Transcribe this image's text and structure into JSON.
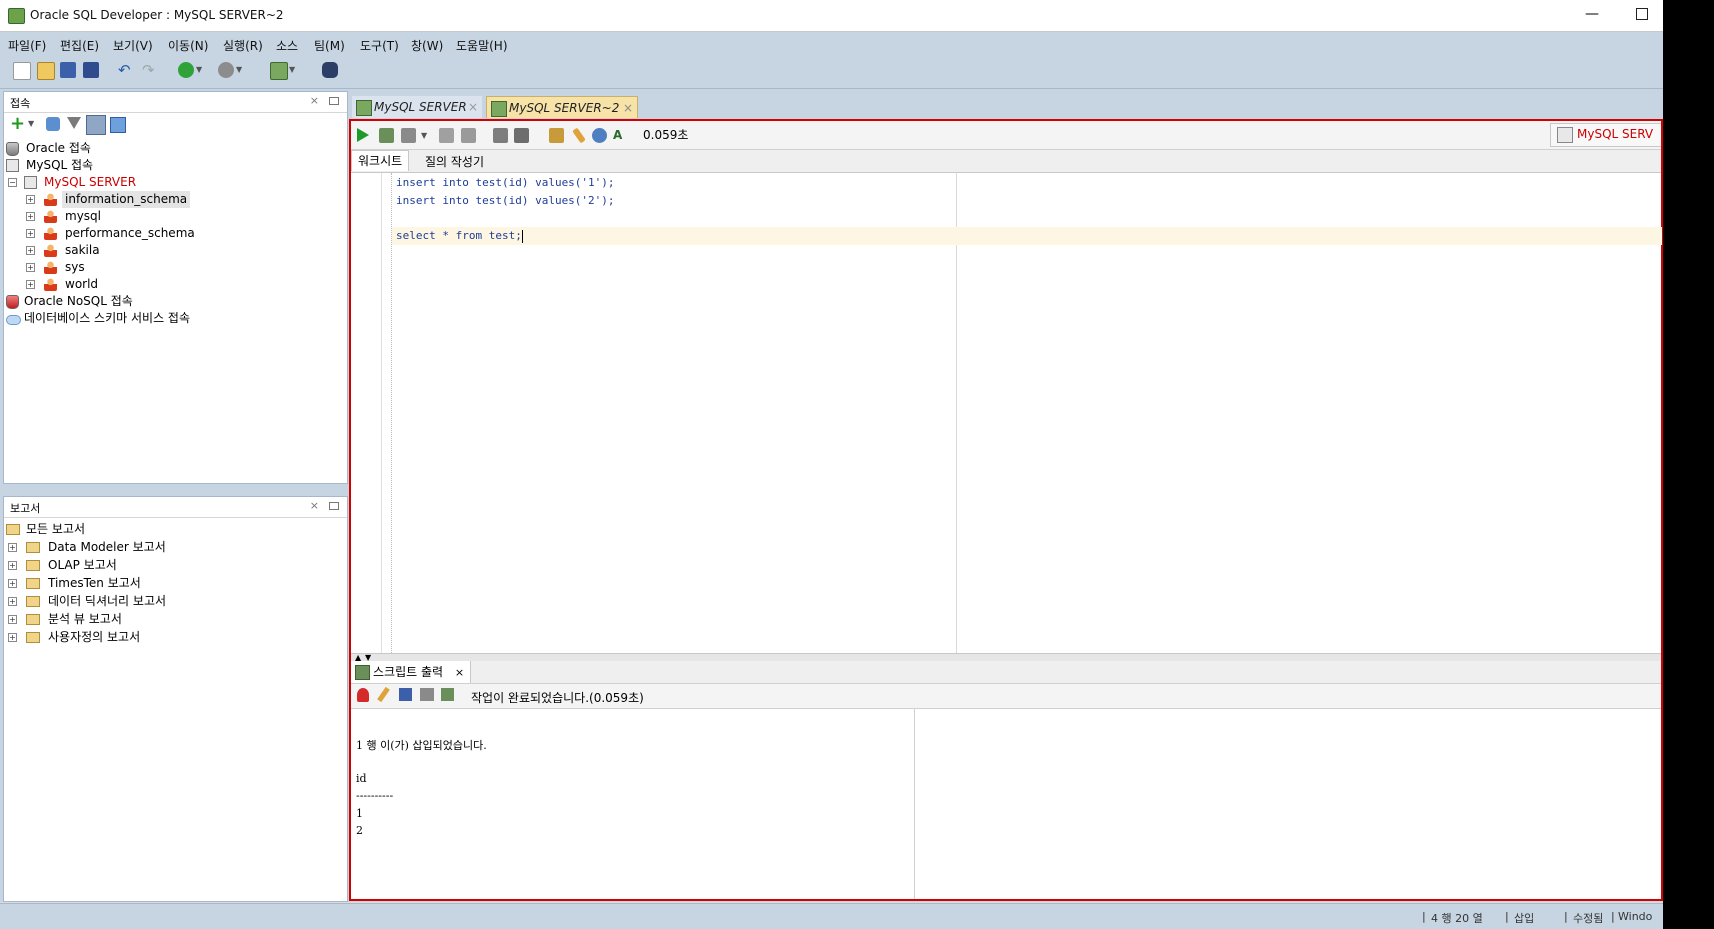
{
  "window": {
    "title": "Oracle SQL Developer : MySQL SERVER~2"
  },
  "menu": [
    "파일(F)",
    "편집(E)",
    "보기(V)",
    "이동(N)",
    "실행(R)",
    "소스",
    "팀(M)",
    "도구(T)",
    "창(W)",
    "도움말(H)"
  ],
  "connections_panel": {
    "title": "접속",
    "close": "×",
    "tree": [
      {
        "label": "Oracle 접속",
        "icon": "database-icon"
      },
      {
        "label": "MySQL 접속",
        "icon": "mysql-connection-icon"
      },
      {
        "label": "MySQL SERVER",
        "icon": "mysql-connection-icon"
      },
      {
        "label": "information_schema",
        "icon": "schema-user-icon"
      },
      {
        "label": "mysql",
        "icon": "schema-user-icon"
      },
      {
        "label": "performance_schema",
        "icon": "schema-user-icon"
      },
      {
        "label": "sakila",
        "icon": "schema-user-icon"
      },
      {
        "label": "sys",
        "icon": "schema-user-icon"
      },
      {
        "label": "world",
        "icon": "schema-user-icon"
      },
      {
        "label": "Oracle NoSQL 접속",
        "icon": "nosql-icon"
      },
      {
        "label": "데이터베이스 스키마 서비스 접속",
        "icon": "cloud-icon"
      }
    ]
  },
  "reports_panel": {
    "title": "보고서",
    "close": "×",
    "tree": [
      {
        "label": "모든 보고서",
        "icon": "reports-folder-icon"
      },
      {
        "label": "Data Modeler 보고서",
        "icon": "folder-icon"
      },
      {
        "label": "OLAP 보고서",
        "icon": "folder-icon"
      },
      {
        "label": "TimesTen 보고서",
        "icon": "folder-icon"
      },
      {
        "label": "데이터 딕셔너리 보고서",
        "icon": "folder-icon"
      },
      {
        "label": "분석 뷰 보고서",
        "icon": "folder-icon"
      },
      {
        "label": "사용자정의 보고서",
        "icon": "folder-icon"
      }
    ]
  },
  "doc_tabs": [
    {
      "label": "MySQL SERVER",
      "close": "×"
    },
    {
      "label": "MySQL SERVER~2",
      "close": "×"
    }
  ],
  "editor": {
    "elapsed": "0.059초",
    "connection_label": "MySQL SERV",
    "subtabs": [
      "워크시트",
      "질의 작성기"
    ],
    "code_lines": [
      "insert into test(id) values('1');",
      "insert into test(id) values('2');",
      "",
      "select * from test;"
    ]
  },
  "output": {
    "tab_label": "스크립트 출력",
    "tab_close": "×",
    "status": "작업이 완료되었습니다.(0.059초)",
    "lines": [
      "1 행 이(가) 삽입되었습니다.",
      "",
      "id",
      "----------",
      "1",
      "2"
    ]
  },
  "statusbar": {
    "position": "4 행 20 열",
    "mode": "삽입",
    "modified": "수정됨",
    "extra": "Windo"
  },
  "colors": {
    "frame_highlight": "#d40000",
    "connection_red": "#cc0000",
    "code_blue": "#1f3c98"
  }
}
